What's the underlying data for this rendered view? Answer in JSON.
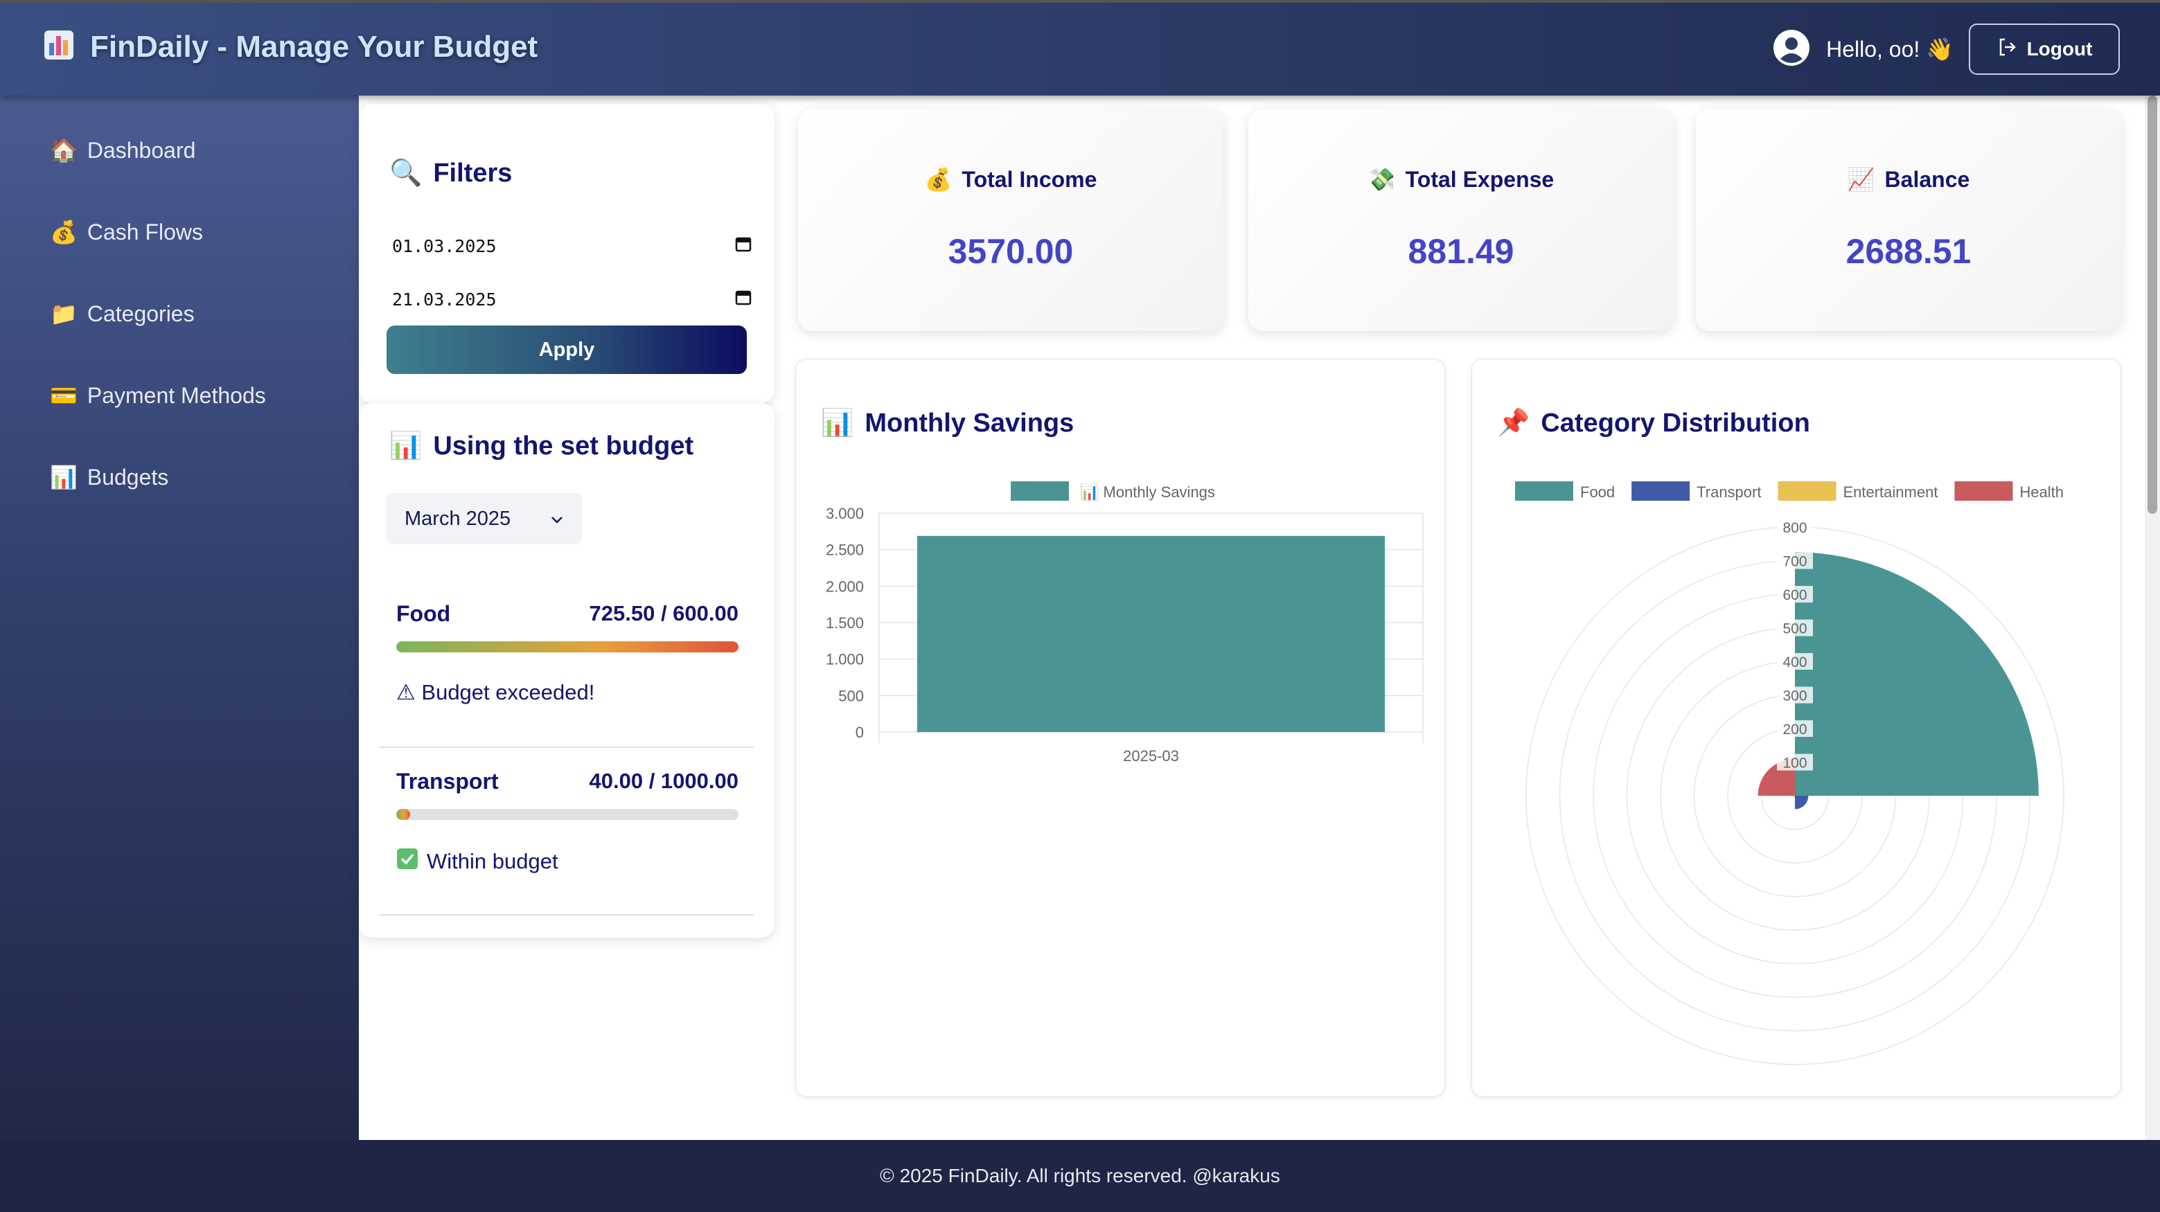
{
  "header": {
    "title": "FinDaily - Manage Your Budget",
    "greeting": "Hello, oo! 👋",
    "logout_label": "Logout"
  },
  "sidebar": {
    "items": [
      {
        "icon": "🏠",
        "label": "Dashboard"
      },
      {
        "icon": "💰",
        "label": "Cash Flows"
      },
      {
        "icon": "📁",
        "label": "Categories"
      },
      {
        "icon": "💳",
        "label": "Payment Methods"
      },
      {
        "icon": "📊",
        "label": "Budgets"
      }
    ]
  },
  "filters": {
    "title": "Filters",
    "start_date": "01.03.2025",
    "end_date": "21.03.2025",
    "apply_label": "Apply"
  },
  "budget": {
    "title": "Using the set budget",
    "selected_month": "March 2025",
    "items": [
      {
        "name": "Food",
        "value": "725.50 / 600.00",
        "progress": 1.0,
        "status": "⚠ Budget exceeded!"
      },
      {
        "name": "Transport",
        "value": "40.00 / 1000.00",
        "progress": 0.04,
        "status": "Within budget"
      }
    ]
  },
  "stats": [
    {
      "icon": "💰",
      "label": "Total Income",
      "value": "3570.00"
    },
    {
      "icon": "💸",
      "label": "Total Expense",
      "value": "881.49"
    },
    {
      "icon": "📈",
      "label": "Balance",
      "value": "2688.51"
    }
  ],
  "savings_chart": {
    "title": "Monthly Savings",
    "legend_label": "📊 Monthly Savings",
    "tick_labels": [
      "3.000",
      "2.500",
      "2.000",
      "1.500",
      "1.000",
      "500",
      "0"
    ]
  },
  "distribution_chart": {
    "title": "Category Distribution",
    "tick_labels": [
      "800",
      "700",
      "600",
      "500",
      "400",
      "300",
      "200",
      "100"
    ]
  },
  "chart_data": [
    {
      "type": "bar",
      "title": "Monthly Savings",
      "categories": [
        "2025-03"
      ],
      "series": [
        {
          "name": "📊 Monthly Savings",
          "values": [
            2688.51
          ]
        }
      ],
      "ylim": [
        0,
        3000
      ],
      "grid": true,
      "legend": "top",
      "colors": [
        "#4a9594"
      ]
    },
    {
      "type": "pie",
      "title": "Category Distribution",
      "categories": [
        "Food",
        "Transport",
        "Entertainment",
        "Health"
      ],
      "values": [
        725.5,
        40,
        5,
        110
      ],
      "rlim": [
        0,
        800
      ],
      "legend": "top",
      "colors": [
        "#4a9594",
        "#3f5aa8",
        "#e8c053",
        "#c95a5e"
      ]
    }
  ],
  "footer": {
    "text": "© 2025 FinDaily. All rights reserved. @karakus"
  }
}
